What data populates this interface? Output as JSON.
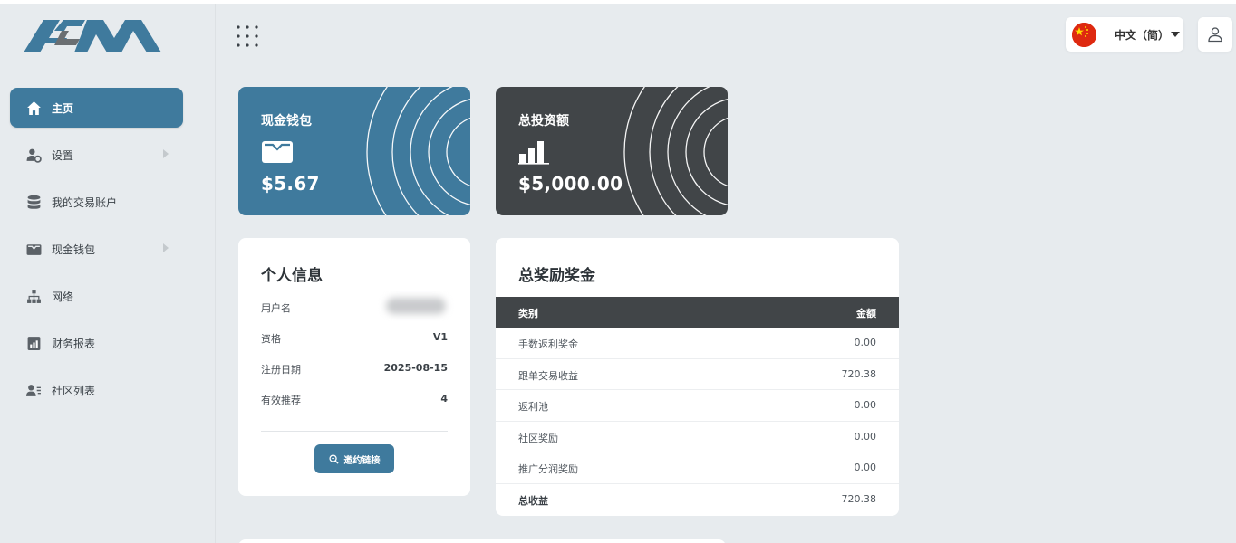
{
  "app": {
    "logo_text": "ACM"
  },
  "sidebar": {
    "items": [
      {
        "label": "主页",
        "icon": "home-icon",
        "active": true,
        "has_submenu": false
      },
      {
        "label": "设置",
        "icon": "user-settings-icon",
        "active": false,
        "has_submenu": true
      },
      {
        "label": "我的交易账户",
        "icon": "database-icon",
        "active": false,
        "has_submenu": false
      },
      {
        "label": "现金钱包",
        "icon": "wallet-icon",
        "active": false,
        "has_submenu": true
      },
      {
        "label": "网络",
        "icon": "network-icon",
        "active": false,
        "has_submenu": false
      },
      {
        "label": "财务报表",
        "icon": "report-icon",
        "active": false,
        "has_submenu": false
      },
      {
        "label": "社区列表",
        "icon": "user-list-icon",
        "active": false,
        "has_submenu": false
      }
    ]
  },
  "header": {
    "apps_icon": "grid-apps-icon",
    "language": {
      "label": "中文（简）",
      "flag": "china-flag-icon"
    },
    "user_icon": "user-icon"
  },
  "cards": {
    "cash_wallet": {
      "title": "现金钱包",
      "value": "$5.67",
      "icon": "wallet-icon",
      "color": "#3f7a9d"
    },
    "total_investment": {
      "title": "总投资额",
      "value": "$5,000.00",
      "icon": "bar-chart-icon",
      "color": "#414548"
    }
  },
  "personal_info": {
    "title": "个人信息",
    "rows": [
      {
        "label": "用户名",
        "value": ""
      },
      {
        "label": "资格",
        "value": "V1"
      },
      {
        "label": "注册日期",
        "value": "2025-08-15"
      },
      {
        "label": "有效推荐",
        "value": "4"
      }
    ],
    "invite_button": "邀约链接"
  },
  "rewards": {
    "title": "总奖励奖金",
    "columns": [
      "类别",
      "金额"
    ],
    "rows": [
      {
        "category": "手数返利奖金",
        "amount": "0.00"
      },
      {
        "category": "跟单交易收益",
        "amount": "720.38"
      },
      {
        "category": "返利池",
        "amount": "0.00"
      },
      {
        "category": "社区奖励",
        "amount": "0.00"
      },
      {
        "category": "推广分润奖励",
        "amount": "0.00"
      }
    ],
    "total": {
      "category": "总收益",
      "amount": "720.38"
    }
  },
  "colors": {
    "accent": "#3f7a9d",
    "dark": "#414548",
    "background": "#e7ebee"
  }
}
